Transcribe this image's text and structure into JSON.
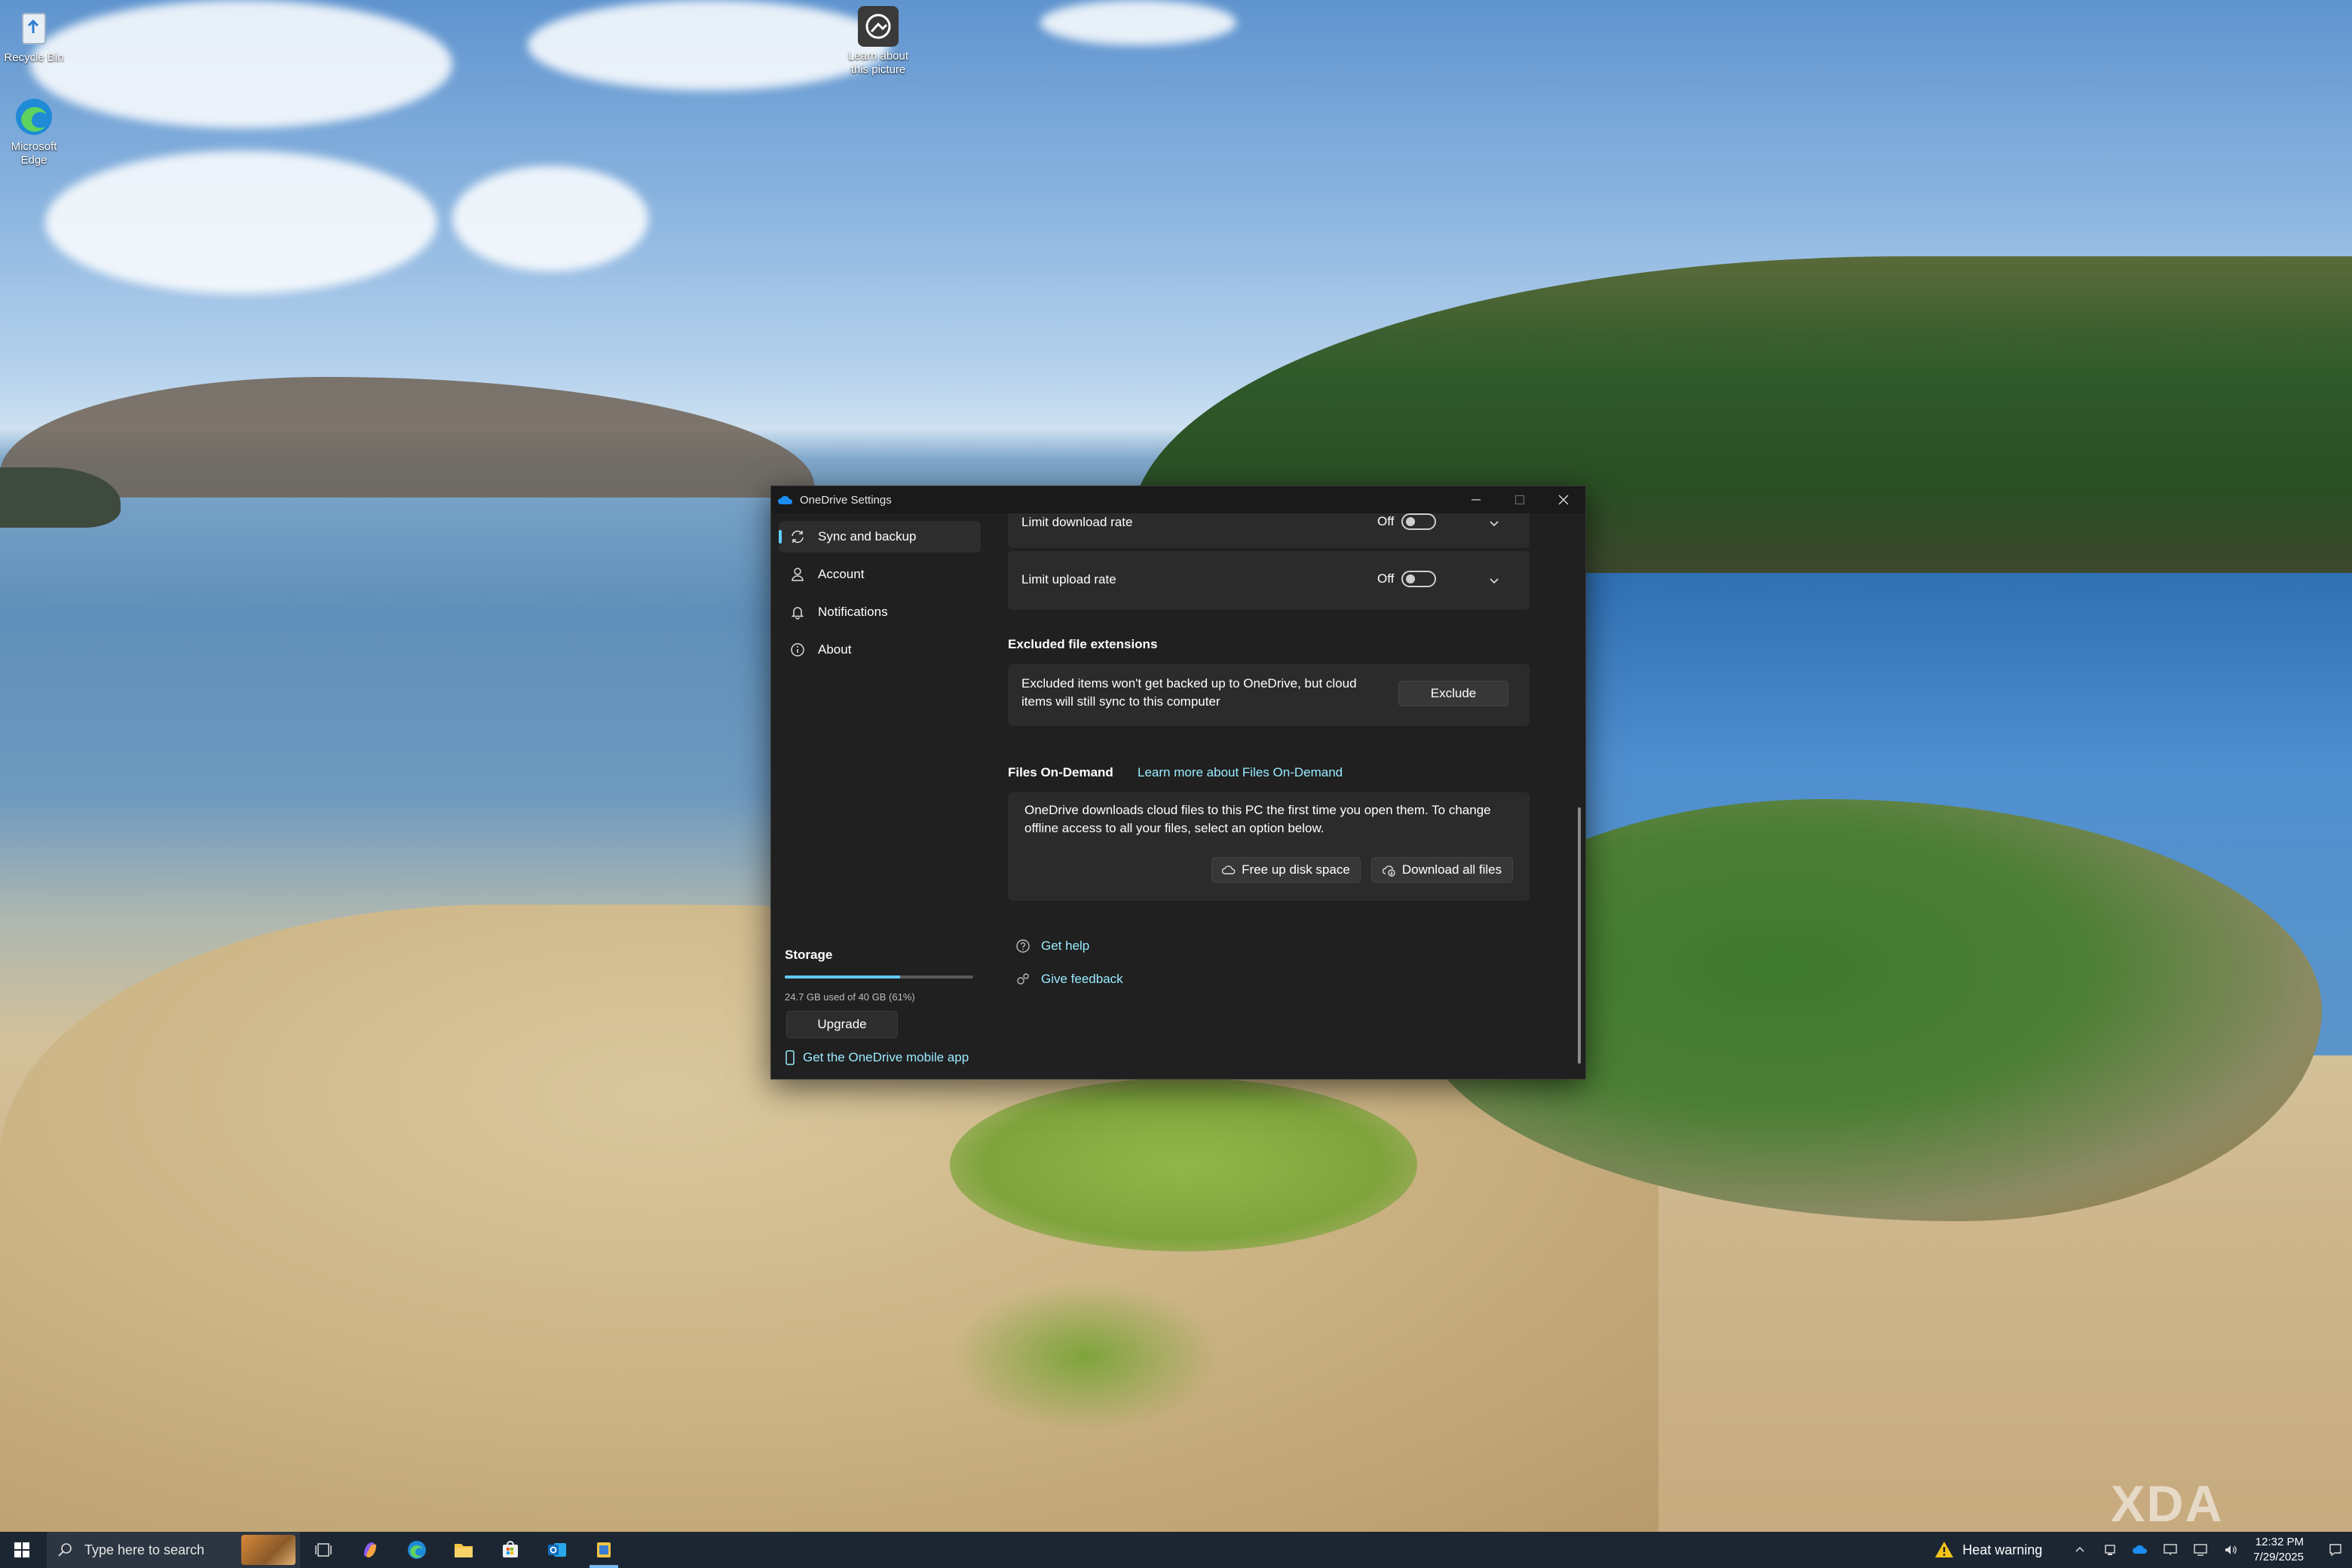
{
  "desktop": {
    "icons": [
      {
        "label": "Recycle Bin"
      },
      {
        "label": "Learn about this picture"
      },
      {
        "label": "Microsoft Edge"
      }
    ],
    "watermark": "XDA"
  },
  "window": {
    "title": "OneDrive Settings",
    "sidebar": {
      "items": [
        {
          "label": "Sync and backup",
          "icon": "sync-icon",
          "active": true
        },
        {
          "label": "Account",
          "icon": "person-icon"
        },
        {
          "label": "Notifications",
          "icon": "bell-icon"
        },
        {
          "label": "About",
          "icon": "info-icon"
        }
      ],
      "storage": {
        "title": "Storage",
        "usage_text": "24.7 GB used of 40 GB (61%)",
        "used_fraction": 0.61,
        "upgrade_label": "Upgrade",
        "mobile_link": "Get the OneDrive mobile app"
      }
    },
    "content": {
      "limit_download": {
        "label": "Limit download rate",
        "state": "Off"
      },
      "limit_upload": {
        "label": "Limit upload rate",
        "state": "Off"
      },
      "excluded": {
        "title": "Excluded file extensions",
        "text_line1": "Excluded items won't get backed up to OneDrive, but cloud",
        "text_line2": "items will still sync to this computer",
        "button": "Exclude"
      },
      "files_on_demand": {
        "title": "Files On-Demand",
        "learn_more": "Learn more about Files On-Demand",
        "text_line1": "OneDrive downloads cloud files to this PC the first time you open them. To change",
        "text_line2": "offline access to all your files, select an option below.",
        "free_up_label": "Free up disk space",
        "download_all_label": "Download all files"
      },
      "get_help": "Get help",
      "give_feedback": "Give feedback"
    }
  },
  "taskbar": {
    "search_placeholder": "Type here to search",
    "heat_warning": "Heat warning",
    "time": "12:32 PM",
    "date": "7/29/2025"
  },
  "colors": {
    "accent": "#60cdff",
    "link": "#99ebff",
    "window_bg": "#202020",
    "card_bg": "#2b2b2b",
    "taskbar_bg": "#1c2633"
  }
}
